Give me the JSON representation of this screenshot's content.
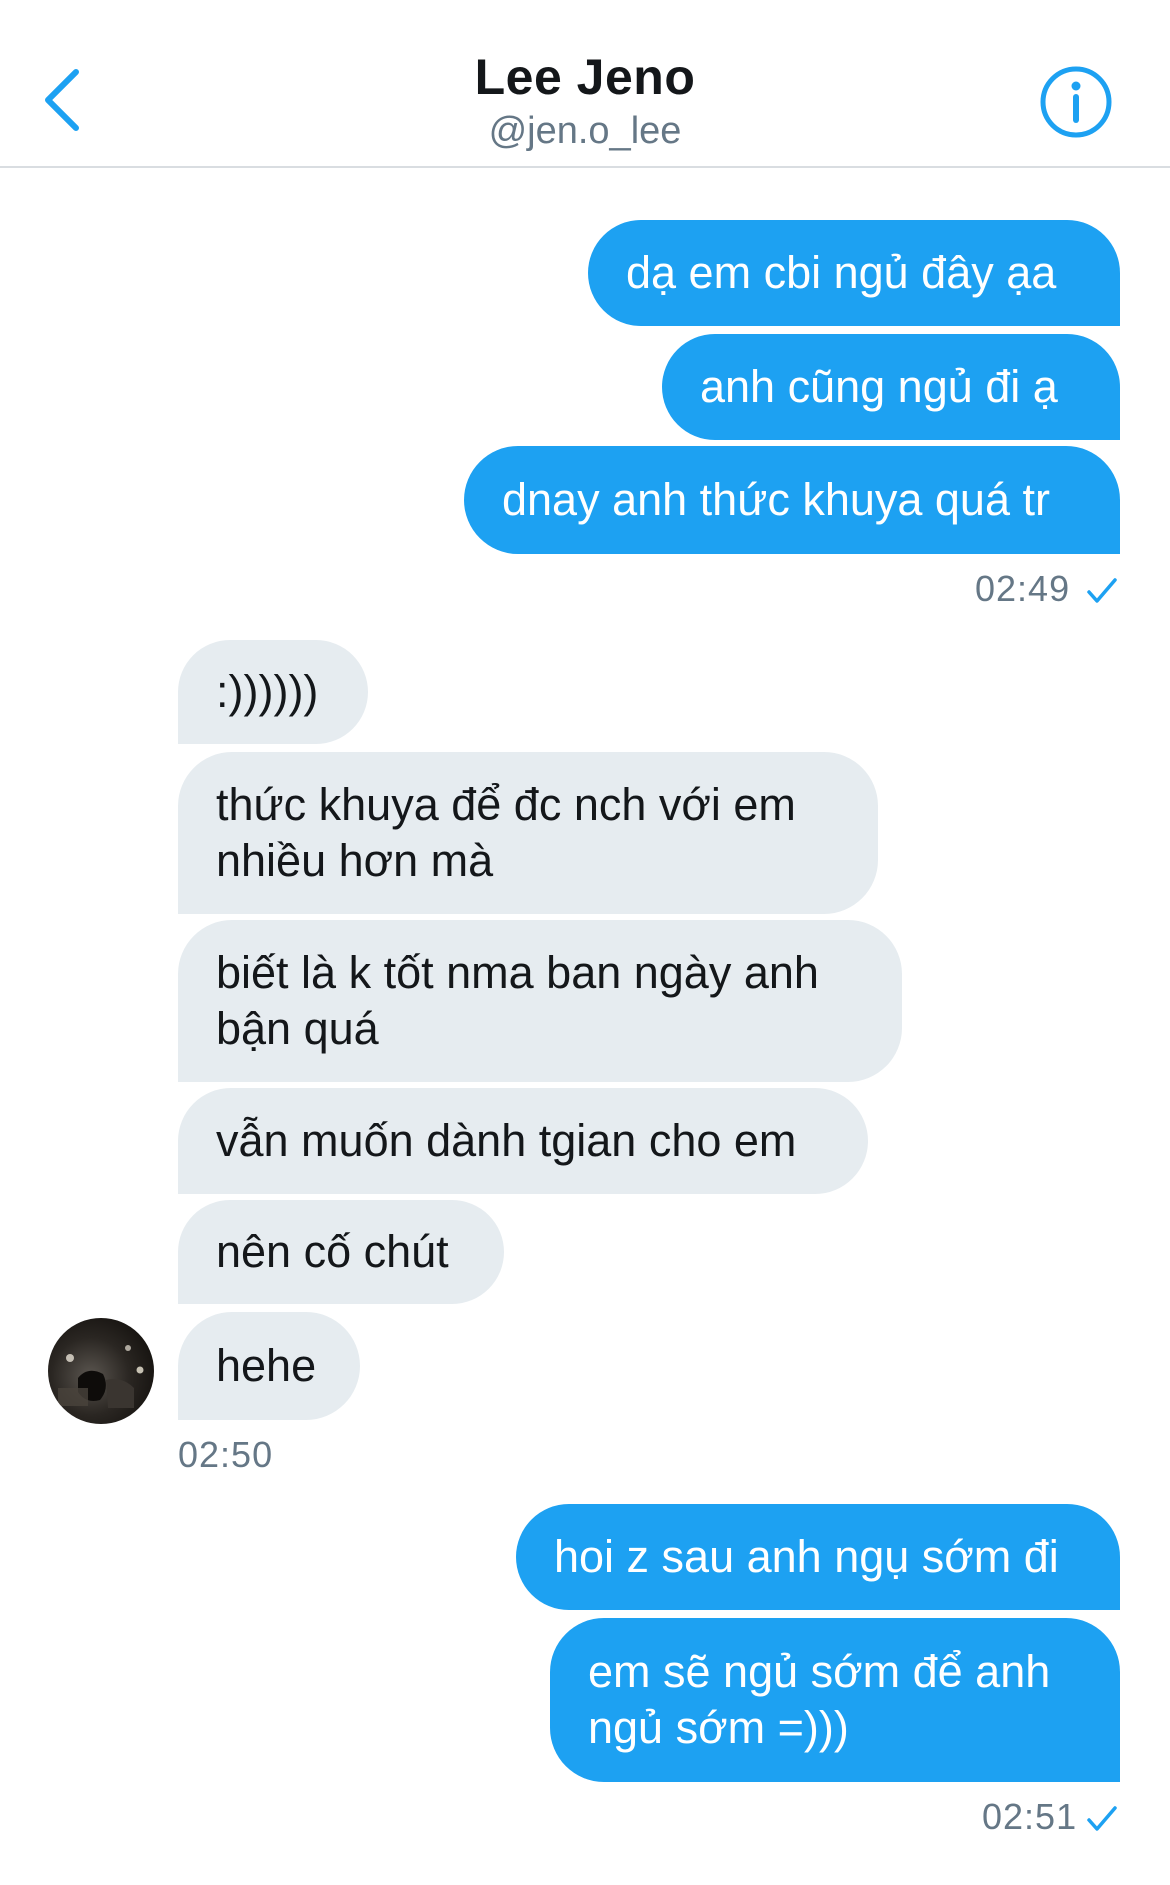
{
  "header": {
    "title": "Lee Jeno",
    "handle": "@jen.o_lee"
  },
  "messages": [
    {
      "side": "sent",
      "text": "dạ em cbi ngủ đây ạa"
    },
    {
      "side": "sent",
      "text": "anh cũng ngủ đi ạ"
    },
    {
      "side": "sent",
      "text": "dnay anh thức khuya quá tr"
    },
    {
      "side": "received",
      "text": ":))))))"
    },
    {
      "side": "received",
      "lines": [
        "thức khuya để đc nch với em",
        "nhiều hơn mà"
      ]
    },
    {
      "side": "received",
      "lines": [
        "biết là k tốt nma ban ngày anh",
        "bận quá"
      ]
    },
    {
      "side": "received",
      "text": "vẫn muốn dành tgian cho em"
    },
    {
      "side": "received",
      "text": "nên cố chút"
    },
    {
      "side": "received",
      "text": "hehe"
    },
    {
      "side": "sent",
      "text": "hoi z sau anh ngụ sớm đi"
    },
    {
      "side": "sent",
      "lines": [
        "em sẽ ngủ sớm để anh",
        "ngủ sớm =)))"
      ]
    }
  ],
  "timestamps": {
    "first_sent": "02:49",
    "received": "02:50",
    "second_sent": "02:51"
  },
  "colors": {
    "accent": "#1da1f2",
    "received_bubble": "#e6ecf0",
    "divider": "#d9dde1",
    "muted_text": "#657786"
  },
  "icons": {
    "back": "chevron-left-icon",
    "info": "info-icon",
    "read_receipt": "check-icon"
  }
}
